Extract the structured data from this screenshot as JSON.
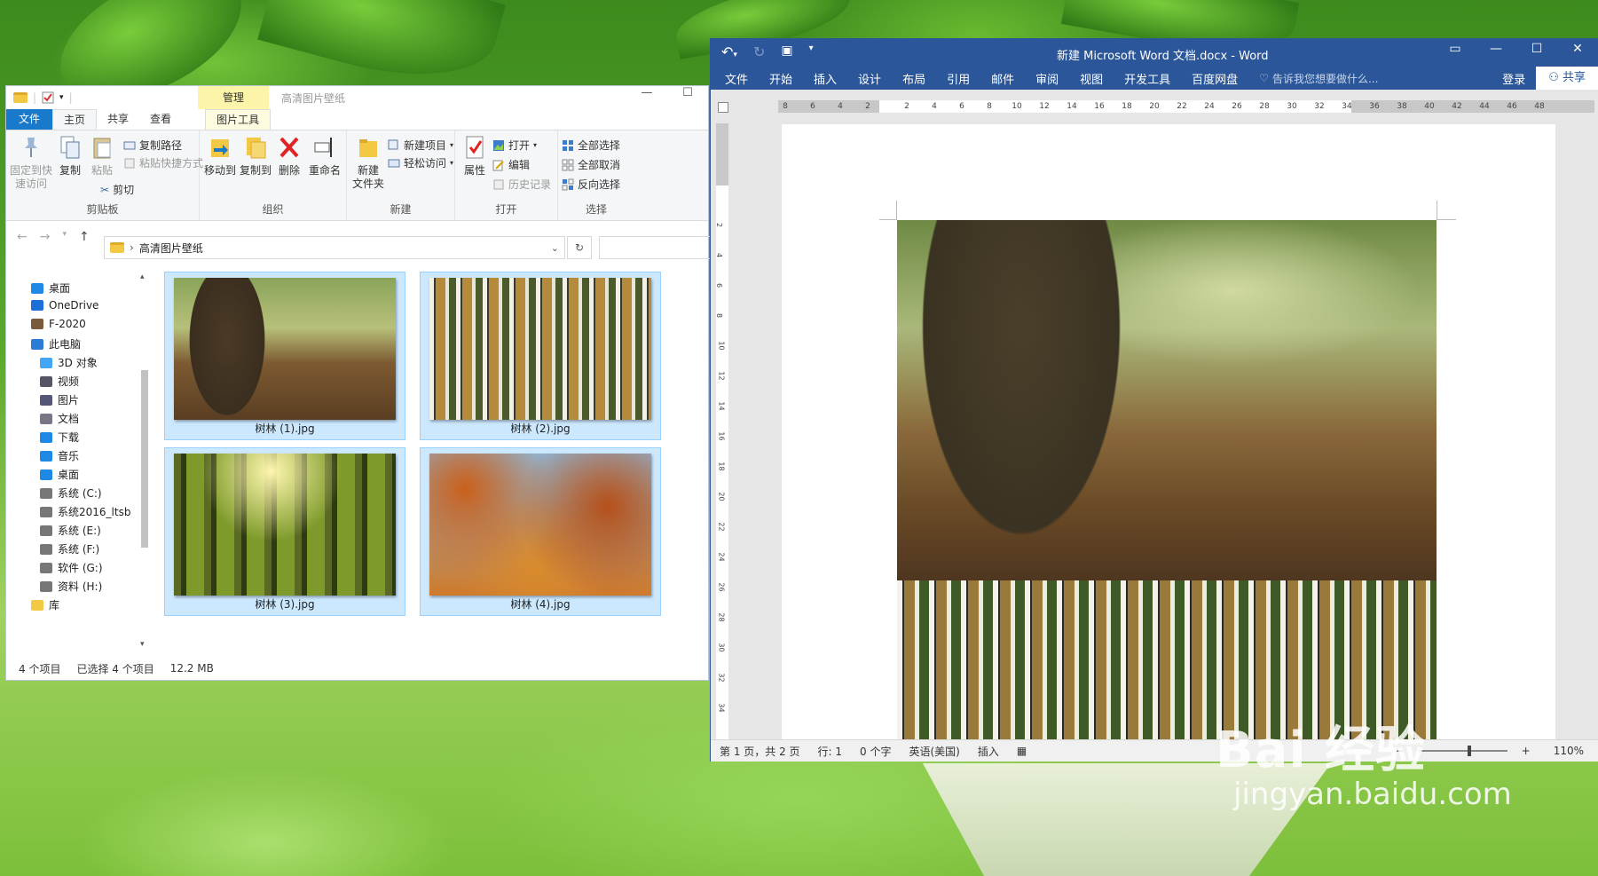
{
  "explorer": {
    "title_context_tab": "管理",
    "window_title": "高清图片壁纸",
    "tabs": [
      "文件",
      "主页",
      "共享",
      "查看",
      "图片工具"
    ],
    "ribbon": {
      "clipboard": {
        "pin": "固定到快\n速访问",
        "copy": "复制",
        "paste": "粘贴",
        "copy_path": "复制路径",
        "paste_shortcut": "粘贴快捷方式",
        "cut": "剪切",
        "label": "剪贴板"
      },
      "organize": {
        "move_to": "移动到",
        "copy_to": "复制到",
        "delete": "删除",
        "rename": "重命名",
        "label": "组织"
      },
      "new": {
        "new_folder": "新建\n文件夹",
        "new_item": "新建项目",
        "easy_access": "轻松访问",
        "label": "新建"
      },
      "open": {
        "properties": "属性",
        "open": "打开",
        "edit": "编辑",
        "history": "历史记录",
        "label": "打开"
      },
      "select": {
        "select_all": "全部选择",
        "select_none": "全部取消",
        "invert": "反向选择",
        "label": "选择"
      }
    },
    "address": "高清图片壁纸",
    "nav": [
      "桌面",
      "OneDrive",
      "F-2020",
      "此电脑",
      "3D 对象",
      "视频",
      "图片",
      "文档",
      "下载",
      "音乐",
      "桌面",
      "系统 (C:)",
      "系统2016_ltsb",
      "系统 (E:)",
      "系统 (F:)",
      "软件 (G:)",
      "资料 (H:)",
      "库"
    ],
    "files": [
      "树林 (1).jpg",
      "树林 (2).jpg",
      "树林 (3).jpg",
      "树林 (4).jpg"
    ],
    "status": {
      "count": "4 个项目",
      "selected": "已选择 4 个项目",
      "size": "12.2 MB"
    }
  },
  "word": {
    "title": "新建 Microsoft Word 文档.docx - Word",
    "menu": [
      "文件",
      "开始",
      "插入",
      "设计",
      "布局",
      "引用",
      "邮件",
      "审阅",
      "视图",
      "开发工具",
      "百度网盘"
    ],
    "tell_me": "告诉我您想要做什么...",
    "login": "登录",
    "share": "共享",
    "ruler_left": [
      "8",
      "6",
      "4",
      "2"
    ],
    "ruler_right": [
      "2",
      "4",
      "6",
      "8",
      "10",
      "12",
      "14",
      "16",
      "18",
      "20",
      "22",
      "24",
      "26",
      "28",
      "30",
      "32",
      "34",
      "36",
      "38",
      "40",
      "42",
      "44",
      "46",
      "48"
    ],
    "ruler_vertical": [
      "2",
      "4",
      "6",
      "8",
      "10",
      "12",
      "14",
      "16",
      "18",
      "20",
      "22",
      "24",
      "26",
      "28",
      "30",
      "32",
      "34"
    ],
    "status": {
      "page": "第 1 页，共 2 页",
      "line": "行: 1",
      "words": "0 个字",
      "lang": "英语(美国)",
      "mode": "插入",
      "zoom": "110%"
    }
  },
  "watermark": {
    "logo": "Bai 经验",
    "url": "jingyan.baidu.com"
  }
}
